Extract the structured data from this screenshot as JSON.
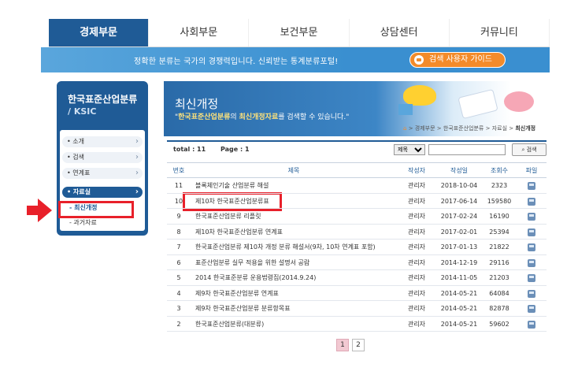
{
  "nav": {
    "tabs": [
      {
        "label": "경제부문",
        "active": true
      },
      {
        "label": "사회부문",
        "active": false
      },
      {
        "label": "보건부문",
        "active": false
      },
      {
        "label": "상담센터",
        "active": false
      },
      {
        "label": "커뮤니티",
        "active": false
      }
    ]
  },
  "banner": {
    "slogan": "정확한 분류는 국가의 경쟁력입니다. 신뢰받는 통계분류포털!",
    "guide_button": "검색 사용자 가이드"
  },
  "sidebar": {
    "brand_title": "한국표준산업분류",
    "brand_sub": "/ KSIC",
    "items": [
      {
        "label": "• 소개",
        "active": false
      },
      {
        "label": "• 검색",
        "active": false
      },
      {
        "label": "• 연계표",
        "active": false
      },
      {
        "label": "• 자료실",
        "active": true
      }
    ],
    "sub_items": [
      {
        "label": "- 최신개정",
        "current": true
      },
      {
        "label": "- 과거자료",
        "current": false
      }
    ]
  },
  "header": {
    "title": "최신개정",
    "desc_prefix": "\"",
    "desc_highlight1": "한국표준산업분류",
    "desc_mid": "의 ",
    "desc_highlight2": "최신개정자료",
    "desc_suffix": "를 검색할 수 있습니다.\"",
    "breadcrumb_path": "> 경제부문 > 한국표준산업분류 > 자료실 > ",
    "breadcrumb_current": "최신개정"
  },
  "toolbar": {
    "total": "total : 11",
    "page": "Page : 1",
    "select_value": "제목",
    "search_button": "검색"
  },
  "table": {
    "headers": {
      "no": "번호",
      "title": "제목",
      "author": "작성자",
      "date": "작성일",
      "views": "조회수",
      "file": "파일"
    },
    "rows": [
      {
        "no": "11",
        "title": "블록체인기술 산업분류 해설",
        "author": "관리자",
        "date": "2018-10-04",
        "views": "2323"
      },
      {
        "no": "10",
        "title": "제10차 한국표준산업분류표",
        "author": "관리자",
        "date": "2017-06-14",
        "views": "159580"
      },
      {
        "no": "9",
        "title": "한국표준산업분류 리플릿",
        "author": "관리자",
        "date": "2017-02-24",
        "views": "16190"
      },
      {
        "no": "8",
        "title": "제10차 한국표준산업분류 연계표",
        "author": "관리자",
        "date": "2017-02-01",
        "views": "25394"
      },
      {
        "no": "7",
        "title": "한국표준산업분류 제10차 개정 분류 해설서(9차, 10차 연계표 포함)",
        "author": "관리자",
        "date": "2017-01-13",
        "views": "21822"
      },
      {
        "no": "6",
        "title": "표준산업분류 실무 적용을 위한 설명서 공람",
        "author": "관리자",
        "date": "2014-12-19",
        "views": "29116"
      },
      {
        "no": "5",
        "title": "2014 한국표준분류 운용법령집(2014.9.24)",
        "author": "관리자",
        "date": "2014-11-05",
        "views": "21203"
      },
      {
        "no": "4",
        "title": "제9차 한국표준산업분류 연계표",
        "author": "관리자",
        "date": "2014-05-21",
        "views": "64084"
      },
      {
        "no": "3",
        "title": "제9차 한국표준산업분류 분류항목표",
        "author": "관리자",
        "date": "2014-05-21",
        "views": "82878"
      },
      {
        "no": "2",
        "title": "한국표준산업분류(대분류)",
        "author": "관리자",
        "date": "2014-05-21",
        "views": "59602"
      }
    ]
  },
  "pager": {
    "pages": [
      "1",
      "2"
    ],
    "current": "1"
  },
  "colors": {
    "primary": "#1f5b96",
    "accent": "#f38b2a",
    "highlight_red": "#e8202a"
  }
}
